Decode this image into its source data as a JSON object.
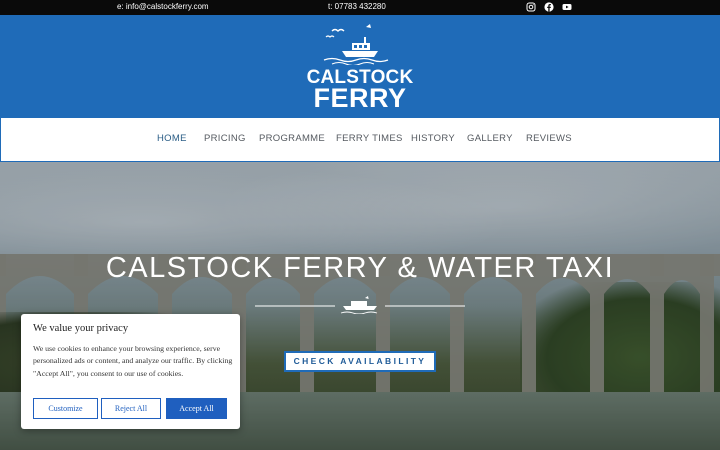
{
  "topbar": {
    "email": "e: info@calstockferry.com",
    "phone": "t: 07783 432280",
    "social": [
      "instagram-icon",
      "facebook-icon",
      "youtube-icon"
    ]
  },
  "logo": {
    "line1": "CALSTOCK",
    "line2": "FERRY"
  },
  "nav": {
    "items": [
      "HOME",
      "PRICING",
      "PROGRAMME",
      "FERRY TIMES",
      "HISTORY",
      "GALLERY",
      "REVIEWS"
    ],
    "active": "HOME"
  },
  "hero": {
    "title": "CALSTOCK FERRY & WATER TAXI",
    "cta": "CHECK AVAILABILITY"
  },
  "cookie": {
    "title": "We value your privacy",
    "body": "We use cookies to enhance your browsing experience, serve personalized ads or content, and analyze our traffic. By clicking \"Accept All\", you consent to our use of cookies.",
    "customize": "Customize",
    "reject": "Reject All",
    "accept": "Accept All"
  },
  "colors": {
    "brand_blue": "#1f6bb8",
    "topbar": "#0a0a0a",
    "button_blue": "#1f5fbf"
  }
}
